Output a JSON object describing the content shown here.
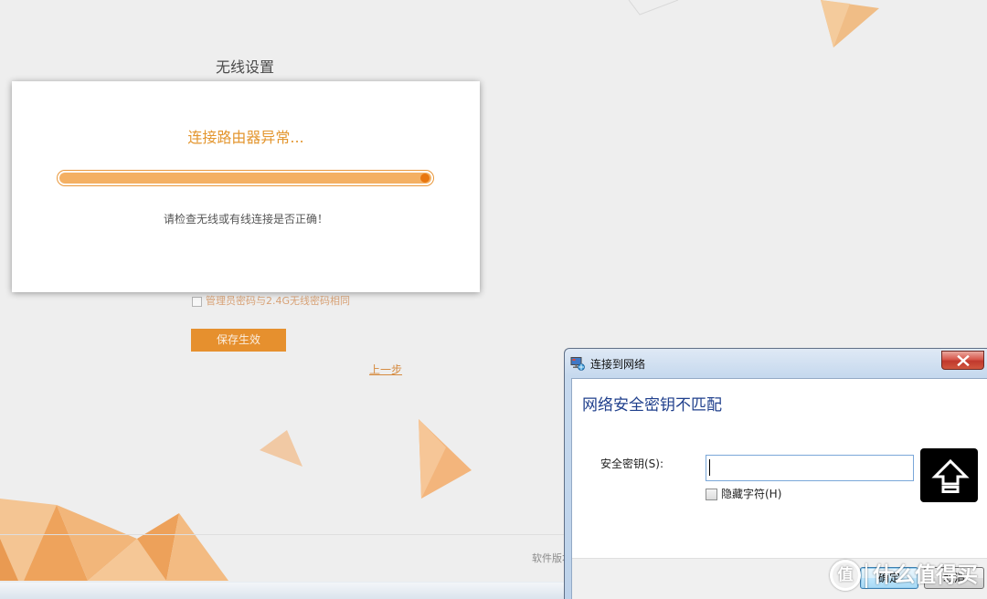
{
  "page": {
    "title": "无线设置",
    "same_password_option": {
      "label": "管理员密码与2.4G无线密码相同",
      "checked": false
    },
    "save_button_label": "保存生效",
    "back_link_label": "上一步",
    "footer_text": "软件版本"
  },
  "router_error_modal": {
    "title": "连接路由器异常...",
    "progress_percent": 100,
    "message": "请检查无线或有线连接是否正确！"
  },
  "network_dialog": {
    "window_title": "连接到网络",
    "title_icon": "network-icon",
    "close_icon": "close-icon",
    "main_instruction": "网络安全密钥不匹配",
    "security_key_label": "安全密钥(S):",
    "security_key_value": "",
    "hide_characters": {
      "label": "隐藏字符(H)",
      "checked": false
    },
    "caps_lock_indicator": "caps-lock-icon",
    "ok_button_label": "确定",
    "cancel_button_label": "取消"
  },
  "watermark": {
    "badge": "值",
    "brand": "什么值得买"
  },
  "colors": {
    "page_bg": "#eeeeee",
    "accent_orange": "#e6902e",
    "modal_title": "#e3962f",
    "progress_fill": "#f4b063",
    "progress_border": "#e9973a",
    "progress_knob": "#e8760f",
    "option_text": "#d8a276",
    "link_text": "#d58a3f",
    "dialog_instruction": "#1f3f8c",
    "close_red": "#cf3f35"
  }
}
